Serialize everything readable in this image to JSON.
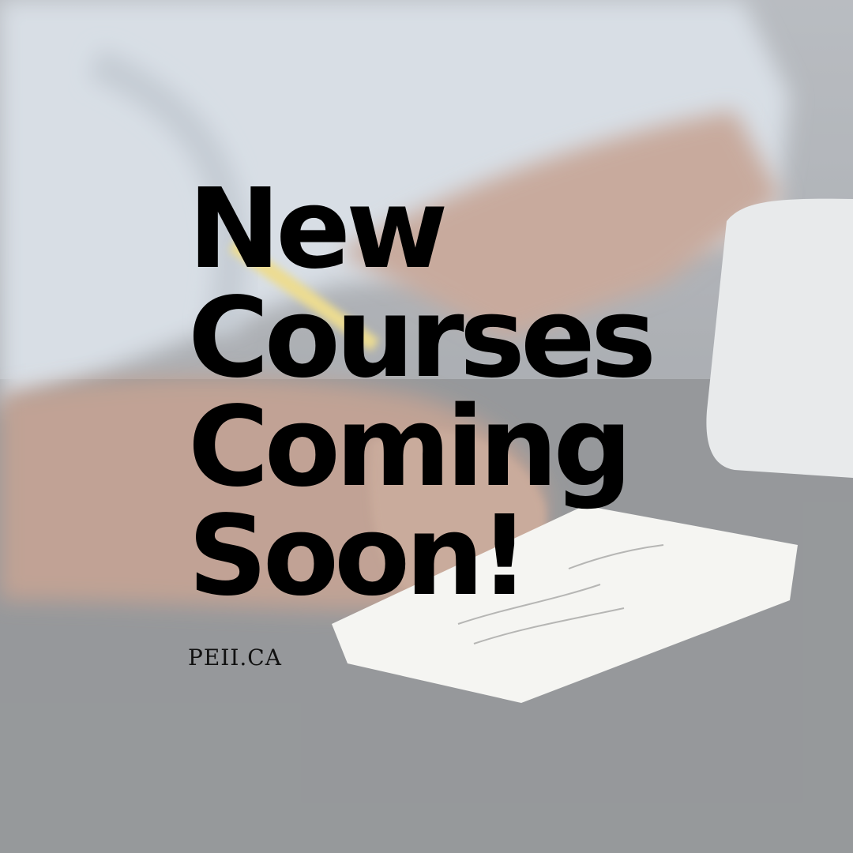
{
  "headline": {
    "line1": "New",
    "line2": "Courses",
    "line3": "Coming",
    "line4": "Soon!"
  },
  "website": "PEII.CA",
  "background": {
    "description_icon": "hand-writing-on-notepad-photo",
    "overlay_color": "#ffffff"
  }
}
